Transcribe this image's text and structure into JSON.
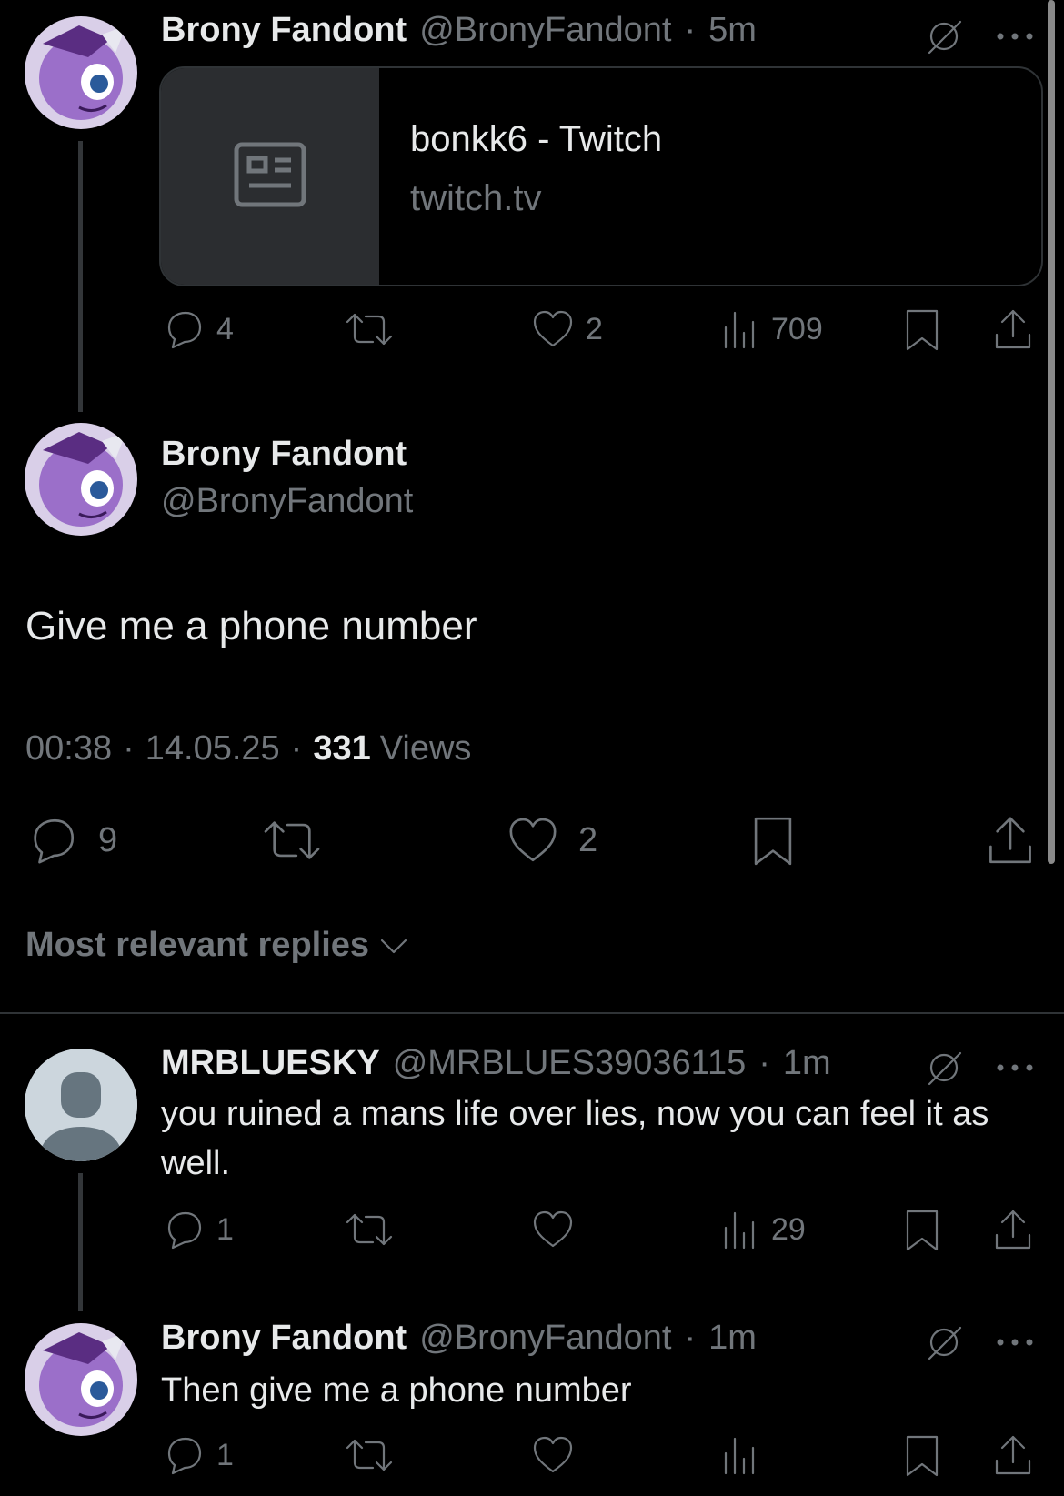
{
  "thread": {
    "post1": {
      "author": "Brony Fandont",
      "handle": "@BronyFandont",
      "sep": "·",
      "time": "5m",
      "card_title": "bonkk6 - Twitch",
      "card_domain": "twitch.tv",
      "replies": "4",
      "likes": "2",
      "views": "709"
    },
    "main": {
      "author": "Brony Fandont",
      "handle": "@BronyFandont",
      "text": "Give me a phone number",
      "time": "00:38",
      "date": "14.05.25",
      "sep": "·",
      "views_count": "331",
      "views_label": "Views",
      "replies": "9",
      "likes": "2"
    },
    "sort_label": "Most relevant replies"
  },
  "replies": [
    {
      "author": "MRBLUESKY",
      "handle": "@MRBLUES39036115",
      "sep": "·",
      "time": "1m",
      "text": "you ruined a mans life over lies, now you can feel it as well.",
      "replies": "1",
      "views": "29"
    },
    {
      "author": "Brony Fandont",
      "handle": "@BronyFandont",
      "sep": "·",
      "time": "1m",
      "text": "Then give me a phone number",
      "replies": "1"
    }
  ],
  "colors": {
    "background": "#000000",
    "text": "#e7e9ea",
    "muted": "#71767b",
    "divider": "#2f3336",
    "avatar_purple": "#8b5fbf"
  }
}
